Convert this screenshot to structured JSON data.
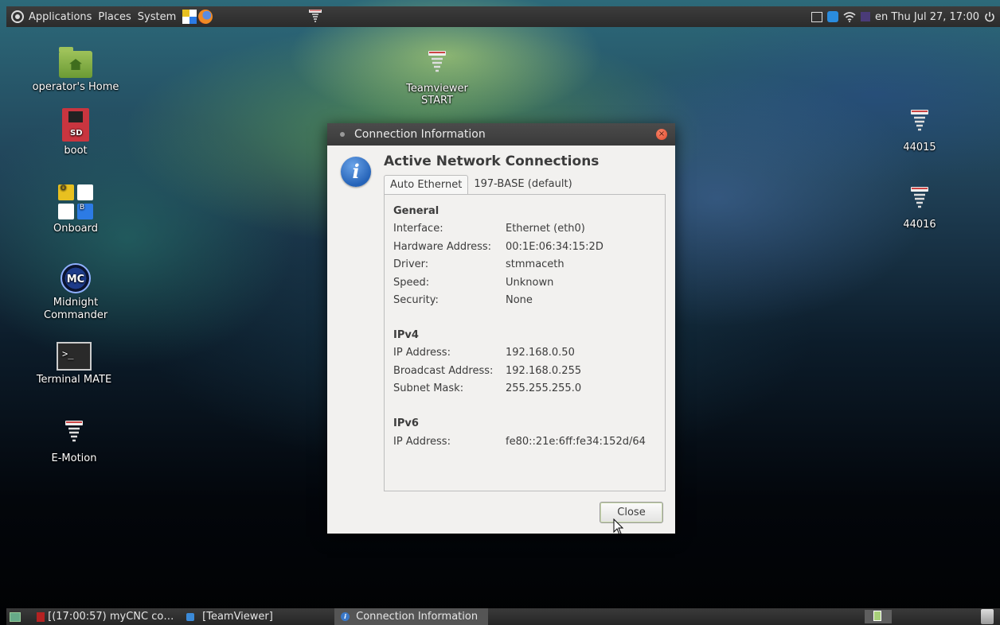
{
  "top_panel": {
    "menus": [
      "Applications",
      "Places",
      "System"
    ],
    "clock": "en Thu Jul 27, 17:00"
  },
  "desktop_icons": {
    "home": "operator's Home",
    "boot": "boot",
    "onboard": "Onboard",
    "onboard_keys": [
      "O",
      "",
      "",
      "B"
    ],
    "mc": "Midnight Commander",
    "mc_badge": "MC",
    "terminal": "Terminal MATE",
    "terminal_glyph": ">_",
    "emotion": "E-Motion",
    "teamviewer": "Teamviewer START",
    "i44015": "44015",
    "i44016": "44016",
    "sd_label": "SD"
  },
  "dialog": {
    "title": "Connection Information",
    "heading": "Active Network Connections",
    "tabs": [
      "Auto Ethernet",
      "197-BASE (default)"
    ],
    "general": {
      "title": "General",
      "rows": [
        {
          "k": "Interface:",
          "v": "Ethernet (eth0)"
        },
        {
          "k": "Hardware Address:",
          "v": "00:1E:06:34:15:2D"
        },
        {
          "k": "Driver:",
          "v": "stmmaceth"
        },
        {
          "k": "Speed:",
          "v": "Unknown"
        },
        {
          "k": "Security:",
          "v": "None"
        }
      ]
    },
    "ipv4": {
      "title": "IPv4",
      "rows": [
        {
          "k": "IP Address:",
          "v": "192.168.0.50"
        },
        {
          "k": "Broadcast Address:",
          "v": "192.168.0.255"
        },
        {
          "k": "Subnet Mask:",
          "v": "255.255.255.0"
        }
      ]
    },
    "ipv6": {
      "title": "IPv6",
      "rows": [
        {
          "k": "IP Address:",
          "v": "fe80::21e:6ff:fe34:152d/64"
        }
      ]
    },
    "close": "Close",
    "info_glyph": "i"
  },
  "taskbar": {
    "items": [
      "[(17:00:57)  myCNC co…",
      "[TeamViewer]",
      "Connection Information"
    ]
  },
  "colors": {
    "panel": "#2b2b2b",
    "close_button": "#e24a2c",
    "info_blue": "#2563b8",
    "folder_green": "#6b9a34"
  }
}
